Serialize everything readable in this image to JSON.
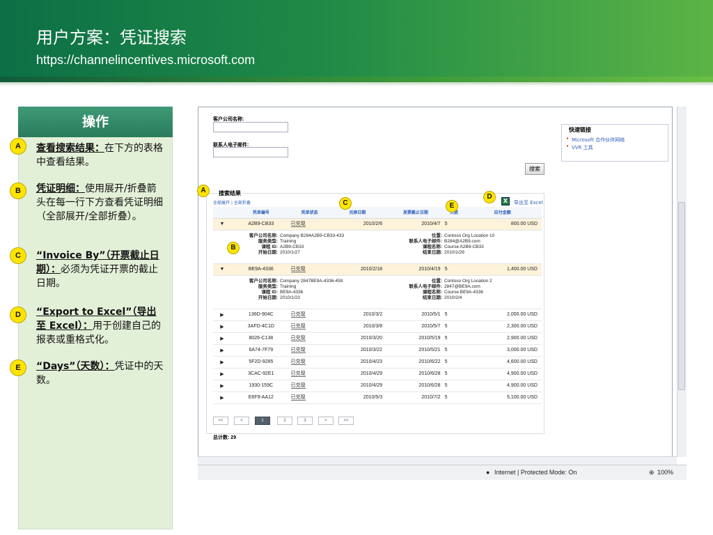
{
  "header": {
    "title": "用户方案：凭证搜索",
    "url": "https://channelincentives.microsoft.com"
  },
  "panel": {
    "heading": "操作",
    "notes": [
      {
        "badge": "A",
        "title": "查看搜索结果：",
        "text": "在下方的表格中查看结果。"
      },
      {
        "badge": "B",
        "title": "凭证明细：",
        "text": "使用展开/折叠箭头在每一行下方查看凭证明细（全部展开/全部折叠）。"
      },
      {
        "badge": "C",
        "title": "“Invoice By”（开票截止日期）：",
        "text": "必须为凭证开票的截止日期。"
      },
      {
        "badge": "D",
        "title": "“Export to Excel”（导出至 Excel）：",
        "text": "用于创建自己的报表或重格式化。"
      },
      {
        "badge": "E",
        "title": "“Days”（天数）：",
        "text": "凭证中的天数。"
      }
    ]
  },
  "form": {
    "customer_label": "客户公司名称:",
    "email_label": "联系人电子邮件:",
    "search_button": "搜索"
  },
  "quick_links": {
    "title": "快速链接",
    "items": [
      "Microsoft 合作伙伴网络",
      "VVR 工具"
    ]
  },
  "results": {
    "title": "搜索结果",
    "expand_all": "全部展开",
    "collapse_all": "全部折叠",
    "link_sep": "|",
    "export_label": "导出至 Excel",
    "export_icon": "excel-icon",
    "columns": [
      "凭单编号",
      "凭单状态",
      "兑换日期",
      "发票截止日期",
      "天数",
      "应付金额"
    ],
    "rows": [
      {
        "id": "A2B9-CB33",
        "status": "已兑现",
        "redeem": "2010/2/6",
        "invoice": "2010/4/7",
        "days": "5",
        "amount": "800.00 USD",
        "detail": {
          "company": "Company B284A2B9-CB33-433",
          "service": "Training",
          "course_id": "A2B9-CB33",
          "start": "2010/1/27",
          "location": "Contoso Org Location 10",
          "email": "B284@A2B9.com",
          "course_name": "Course A2B9-CB33",
          "end": "2010/1/29"
        }
      },
      {
        "id": "BE9A-4336",
        "status": "已兑现",
        "redeem": "2010/2/18",
        "invoice": "2010/4/19",
        "days": "5",
        "amount": "1,400.00 USD",
        "detail": {
          "company": "Company 2847BE9A-4336-459",
          "service": "Training",
          "course_id": "BE9A-4336",
          "start": "2010/1/23",
          "location": "Contoso Org Location 2",
          "email": "2847@BE9A.com",
          "course_name": "Course BE9A-4336",
          "end": "2010/2/4"
        }
      },
      {
        "id": "136D-904C",
        "status": "已兑现",
        "redeem": "2010/3/2",
        "invoice": "2010/5/1",
        "days": "5",
        "amount": "2,000.00 USD"
      },
      {
        "id": "3AFD-4C1D",
        "status": "已兑现",
        "redeem": "2010/3/8",
        "invoice": "2010/5/7",
        "days": "5",
        "amount": "2,300.00 USD"
      },
      {
        "id": "8026-C138",
        "status": "已兑现",
        "redeem": "2010/3/20",
        "invoice": "2010/5/19",
        "days": "5",
        "amount": "2,900.00 USD"
      },
      {
        "id": "6A74-7F79",
        "status": "已兑现",
        "redeem": "2010/3/22",
        "invoice": "2010/5/21",
        "days": "5",
        "amount": "3,000.00 USD"
      },
      {
        "id": "5F2D-9285",
        "status": "已兑现",
        "redeem": "2010/4/23",
        "invoice": "2010/6/22",
        "days": "5",
        "amount": "4,600.00 USD"
      },
      {
        "id": "3CAC-92E1",
        "status": "已兑现",
        "redeem": "2010/4/29",
        "invoice": "2010/6/28",
        "days": "5",
        "amount": "4,900.00 USD"
      },
      {
        "id": "1930-159C",
        "status": "已兑现",
        "redeem": "2010/4/29",
        "invoice": "2010/6/28",
        "days": "5",
        "amount": "4,900.00 USD"
      },
      {
        "id": "E6F9-AA12",
        "status": "已兑现",
        "redeem": "2010/5/3",
        "invoice": "2010/7/2",
        "days": "5",
        "amount": "5,100.00 USD"
      }
    ],
    "detail_labels": {
      "company": "客户公司名称:",
      "service": "服务类型:",
      "course_id": "课程 ID:",
      "start": "开始日期:",
      "location": "位置:",
      "email": "联系人电子邮件:",
      "course_name": "课程名称:",
      "end": "结束日期:"
    },
    "pager": [
      "<<",
      "<",
      "1",
      "2",
      "3",
      ">",
      ">>"
    ],
    "current_page": "1",
    "total_label": "总计数:",
    "total": "29"
  },
  "status_bar": {
    "zone": "Internet | Protected Mode: On",
    "zoom": "100%"
  },
  "callouts": [
    "A",
    "B",
    "C",
    "D",
    "E"
  ],
  "colors": {
    "brand_green": "#1f8a47",
    "panel_bg": "#e3f0d8",
    "panel_head": "#2a7c5c",
    "badge": "#ffe400"
  }
}
